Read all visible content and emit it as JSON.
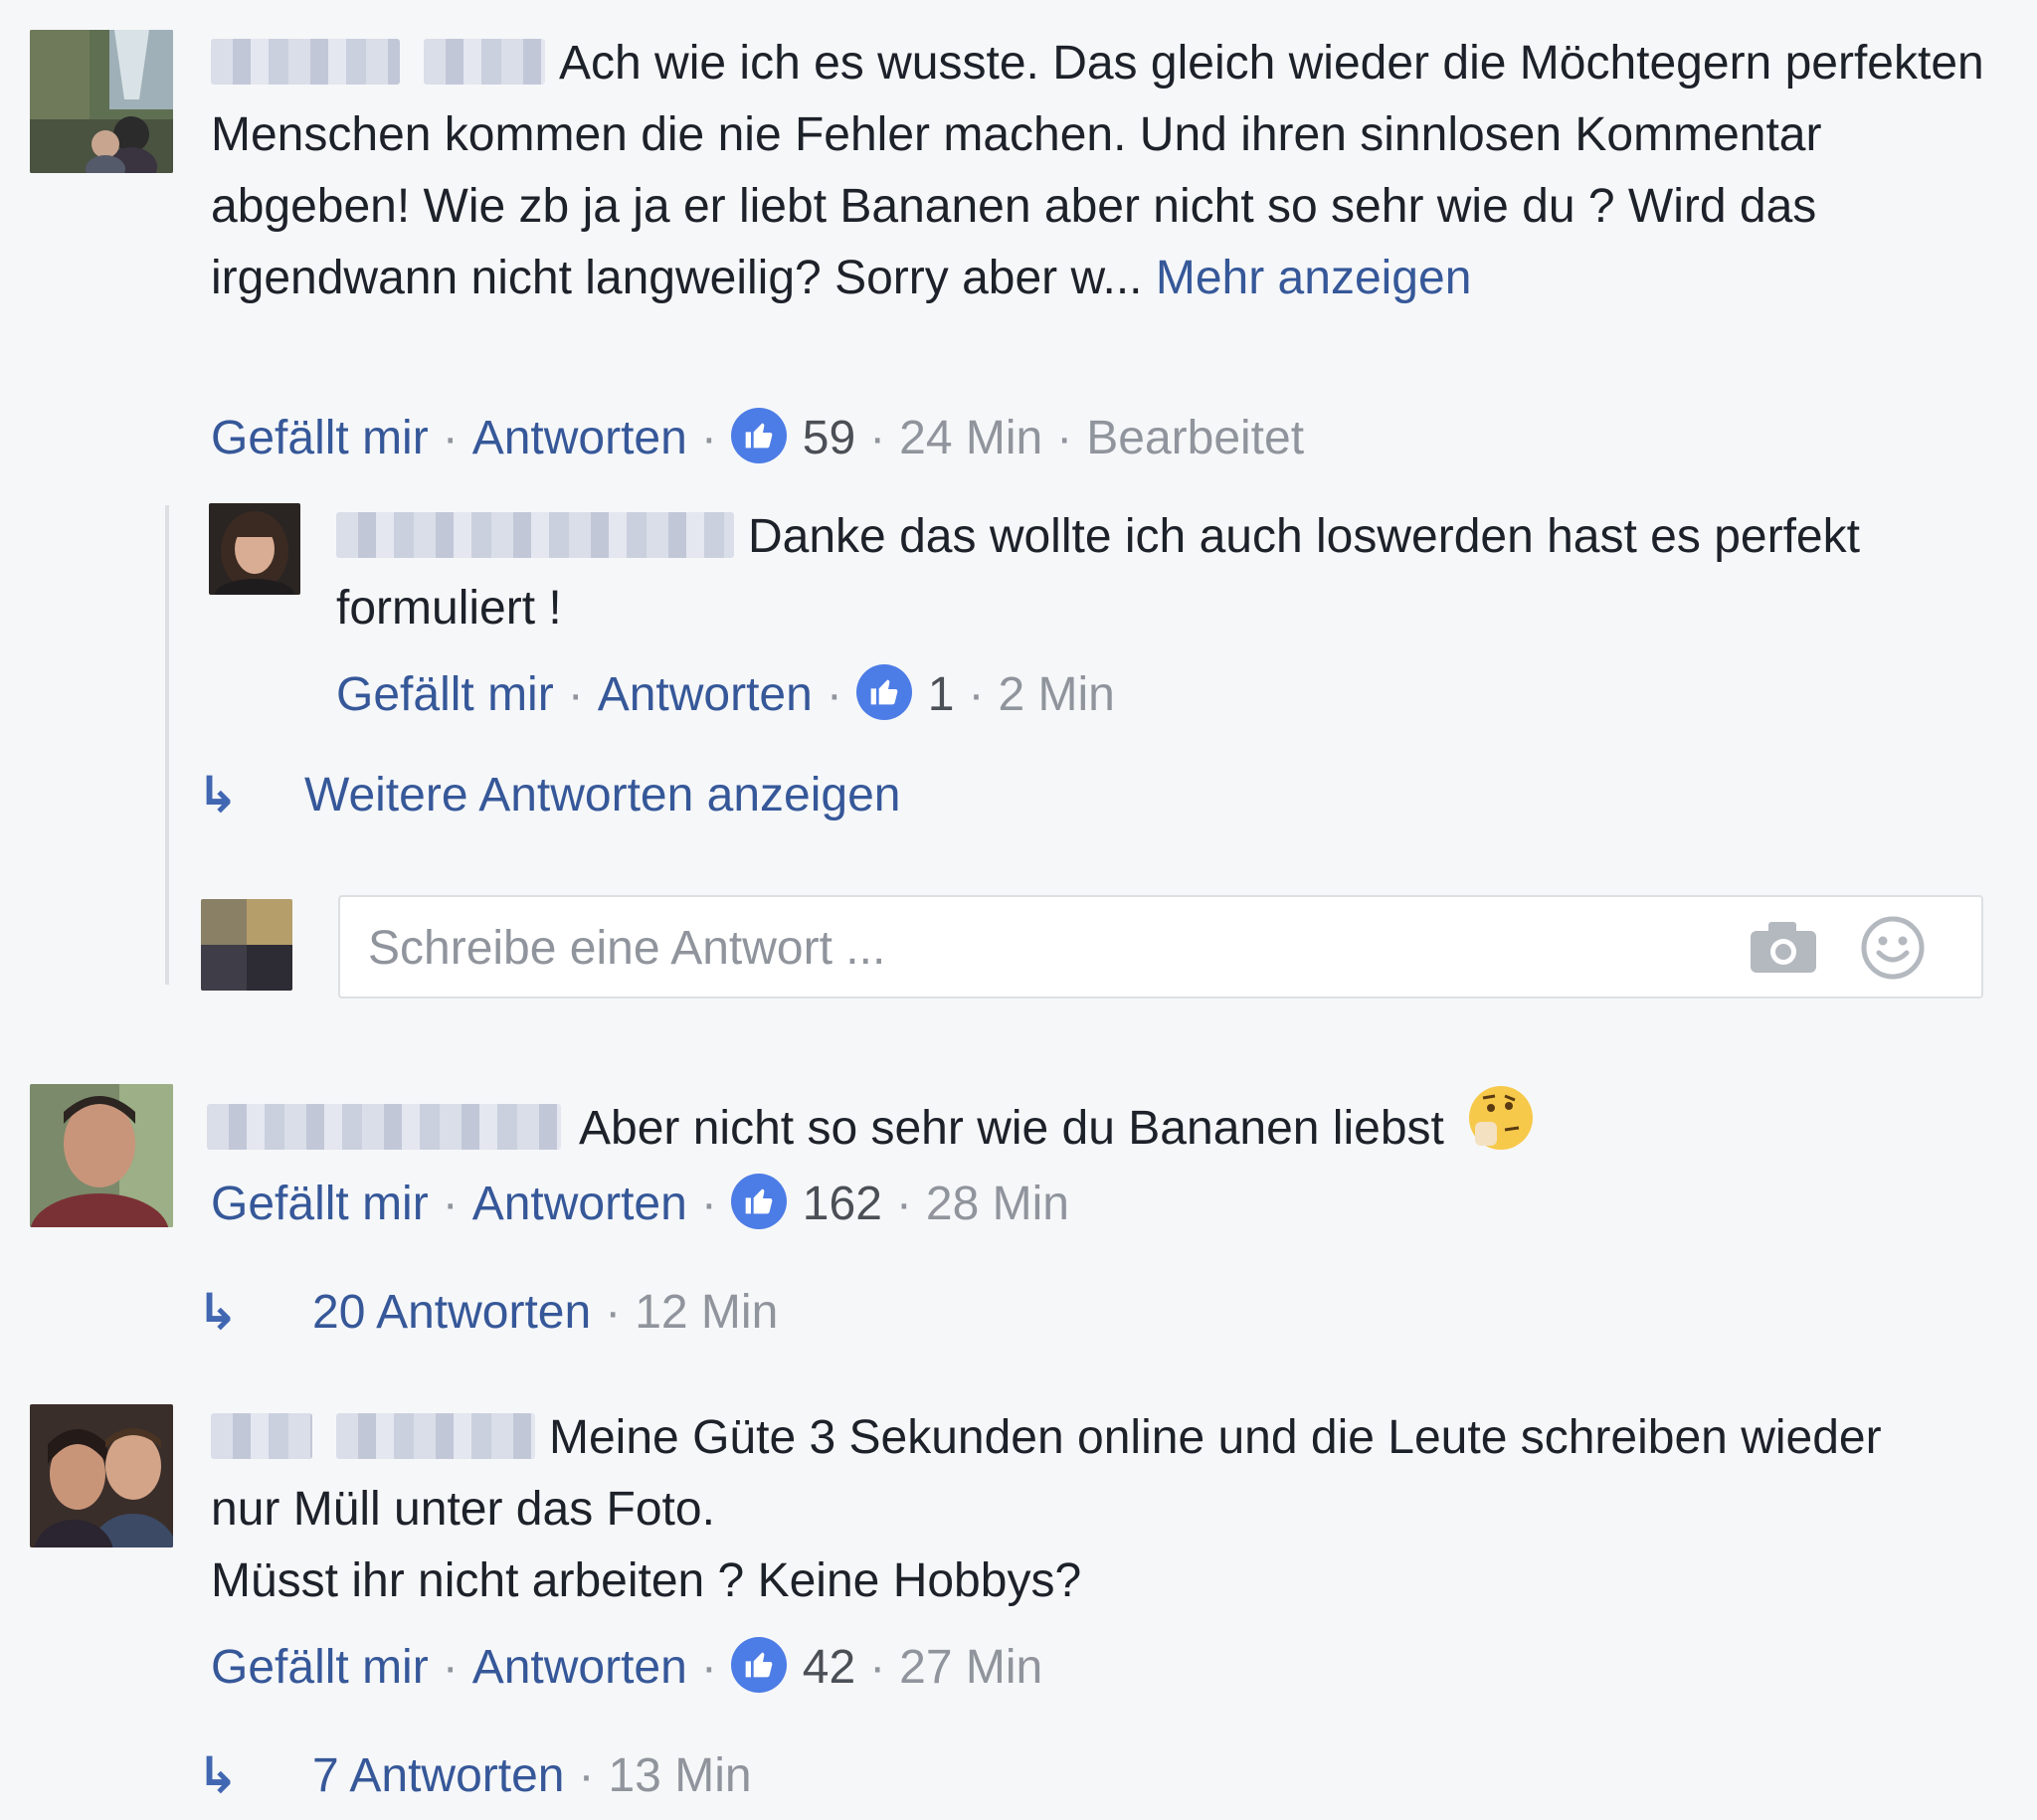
{
  "comments": [
    {
      "text": "Ach wie ich es wusste. Das gleich wieder die Möchtegern perfekten Menschen kommen die nie Fehler machen. Und ihren sinnlosen Kommentar abgeben! Wie zb ja ja er liebt Bananen aber nicht so sehr wie du ? Wird das irgendwann nicht langweilig? Sorry aber w...",
      "more_label": "Mehr anzeigen",
      "like_label": "Gefällt mir",
      "reply_label": "Antworten",
      "likes": "59",
      "time": "24 Min",
      "edited": "Bearbeitet",
      "replies": [
        {
          "text": "Danke das wollte ich auch loswerden hast es perfekt formuliert !",
          "like_label": "Gefällt mir",
          "reply_label": "Antworten",
          "likes": "1",
          "time": "2 Min"
        }
      ],
      "more_replies_label": "Weitere Antworten anzeigen",
      "reply_placeholder": "Schreibe eine Antwort ..."
    },
    {
      "text": "Aber nicht so sehr wie du Bananen liebst",
      "like_label": "Gefällt mir",
      "reply_label": "Antworten",
      "likes": "162",
      "time": "28 Min",
      "replies_summary": "20 Antworten",
      "replies_time": "12 Min"
    },
    {
      "text_line1": "Meine Güte 3 Sekunden online und die Leute schreiben wieder nur Müll unter das Foto.",
      "text_line2": "Müsst ihr nicht arbeiten ? Keine Hobbys?",
      "like_label": "Gefällt mir",
      "reply_label": "Antworten",
      "likes": "42",
      "time": "27 Min",
      "replies_summary": "7 Antworten",
      "replies_time": "13 Min"
    }
  ],
  "icons": {
    "like": "thumbs-up-icon",
    "reply_arrow": "reply-arrow-icon",
    "camera": "camera-icon",
    "emoji": "smiley-icon",
    "emoji_in_text": "thinking-face-emoji"
  },
  "colors": {
    "link": "#365899",
    "like_badge": "#4c7ce6",
    "background": "#f6f7f9"
  }
}
